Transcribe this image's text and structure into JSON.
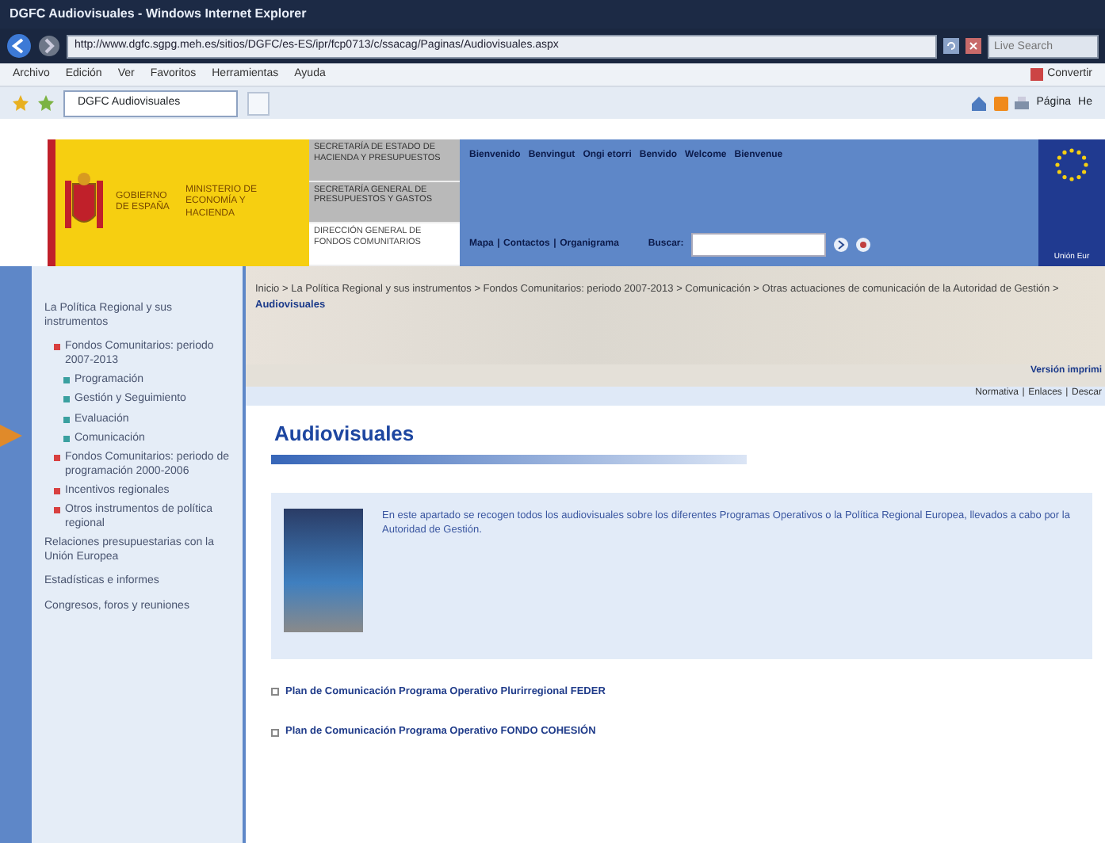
{
  "window": {
    "title": "DGFC Audiovisuales - Windows Internet Explorer"
  },
  "address_bar": {
    "url": "http://www.dgfc.sgpg.meh.es/sitios/DGFC/es-ES/ipr/fcp0713/c/ssacag/Paginas/Audiovisuales.aspx",
    "search_placeholder": "Live Search"
  },
  "menu_bar": {
    "items": [
      "Archivo",
      "Edición",
      "Ver",
      "Favoritos",
      "Herramientas",
      "Ayuda"
    ],
    "convert": "Convertir"
  },
  "tabs": [
    {
      "label": "DGFC Audiovisuales",
      "selected": true
    }
  ],
  "command_bar": {
    "page": "Página",
    "tools": "He"
  },
  "header": {
    "government": "GOBIERNO DE ESPAÑA",
    "ministry": "MINISTERIO DE ECONOMÍA Y HACIENDA",
    "units": [
      {
        "label": "SECRETARÍA DE ESTADO DE HACIENDA Y PRESUPUESTOS",
        "selected": false
      },
      {
        "label": "SECRETARÍA GENERAL DE PRESUPUESTOS Y GASTOS",
        "selected": false
      },
      {
        "label": "DIRECCIÓN GENERAL DE FONDOS COMUNITARIOS",
        "selected": true
      }
    ],
    "languages": [
      "Bienvenido",
      "Benvingut",
      "Ongi etorri",
      "Benvido",
      "Welcome",
      "Bienvenue"
    ],
    "links": [
      "Mapa",
      "Contactos",
      "Organigrama"
    ],
    "search_label": "Buscar:",
    "eu_label": "Unión Eur"
  },
  "sidebar": {
    "items": [
      {
        "label": "La Política Regional y sus instrumentos",
        "children": [
          {
            "label": "Fondos Comunitarios: periodo 2007-2013",
            "children": [
              {
                "label": "Programación"
              },
              {
                "label": "Gestión y Seguimiento"
              },
              {
                "label": "Evaluación"
              },
              {
                "label": "Comunicación"
              }
            ]
          },
          {
            "label": "Fondos Comunitarios: periodo de programación 2000-2006"
          },
          {
            "label": "Incentivos regionales"
          },
          {
            "label": "Otros instrumentos de política regional"
          }
        ]
      },
      {
        "label": "Relaciones presupuestarias con la Unión Europea"
      },
      {
        "label": "Estadísticas e informes"
      },
      {
        "label": "Congresos, foros y reuniones"
      }
    ]
  },
  "breadcrumb": "Inicio > La Política Regional y sus instrumentos > Fondos Comunitarios: periodo 2007-2013 > Comunicación > Otras actuaciones de comunicación de la Autoridad de Gestión > **Audiovisuales**",
  "link_separator": "|",
  "print_version": "Versión imprimi",
  "utility_links": [
    "Normativa",
    "Enlaces",
    "Descar"
  ],
  "page_title": "Audiovisuales",
  "intro": "En este apartado se recogen todos los audiovisuales sobre los diferentes Programas Operativos o la Política Regional Europea, llevados a cabo por la Autoridad de Gestión.",
  "links": [
    "Plan de Comunicación Programa Operativo Plurirregional FEDER",
    "Plan de Comunicación Programa Operativo FONDO COHESIÓN"
  ]
}
